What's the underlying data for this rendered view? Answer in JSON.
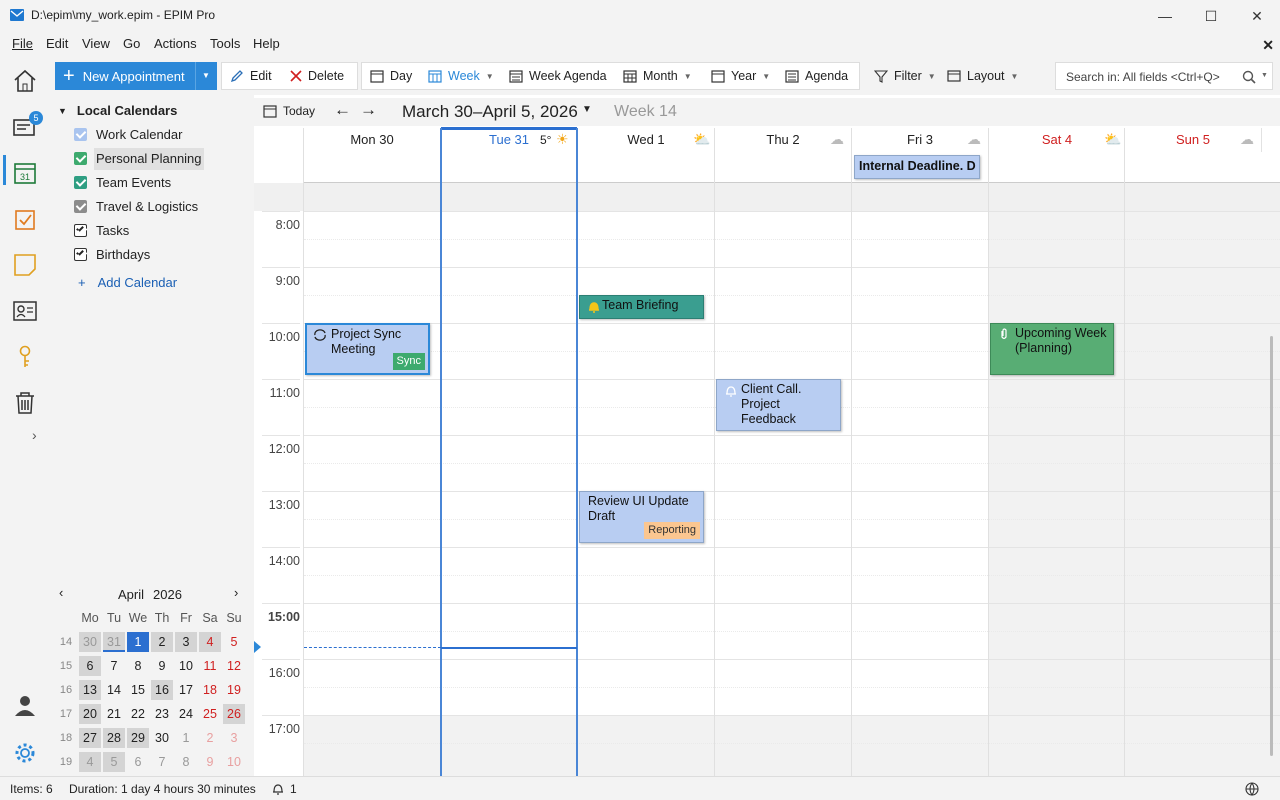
{
  "window": {
    "title": "D:\\epim\\my_work.epim - EPIM Pro",
    "minimize": "—",
    "maximize": "☐",
    "close": "✕"
  },
  "menu": {
    "file": "File",
    "edit": "Edit",
    "view": "View",
    "go": "Go",
    "actions": "Actions",
    "tools": "Tools",
    "help": "Help",
    "close": "✕"
  },
  "toolbar": {
    "new_appointment": "New Appointment",
    "edit": "Edit",
    "delete": "Delete",
    "day": "Day",
    "week": "Week",
    "week_agenda": "Week Agenda",
    "month": "Month",
    "year": "Year",
    "agenda": "Agenda",
    "filter": "Filter",
    "layout": "Layout",
    "search_placeholder": "Search in: All fields <Ctrl+Q>"
  },
  "navrail": {
    "badge": "5",
    "expand": "›"
  },
  "sidebar": {
    "header": "Local Calendars",
    "calendars": [
      {
        "label": "Work Calendar",
        "color": "#a9c4ef"
      },
      {
        "label": "Personal Planning",
        "color": "#3daa6e"
      },
      {
        "label": "Team Events",
        "color": "#2e9e82"
      },
      {
        "label": "Travel & Logistics",
        "color": "#8c8c8c"
      },
      {
        "label": "Tasks",
        "color": "#ffffff"
      },
      {
        "label": "Birthdays",
        "color": "#ffffff"
      }
    ],
    "add_calendar": "Add Calendar"
  },
  "minical": {
    "month": "April",
    "year": "2026",
    "weekdays": [
      "Mo",
      "Tu",
      "We",
      "Th",
      "Fr",
      "Sa",
      "Su"
    ],
    "weeks": [
      {
        "wk": "14",
        "days": [
          "30",
          "31",
          "1",
          "2",
          "3",
          "4",
          "5"
        ]
      },
      {
        "wk": "15",
        "days": [
          "6",
          "7",
          "8",
          "9",
          "10",
          "11",
          "12"
        ]
      },
      {
        "wk": "16",
        "days": [
          "13",
          "14",
          "15",
          "16",
          "17",
          "18",
          "19"
        ]
      },
      {
        "wk": "17",
        "days": [
          "20",
          "21",
          "22",
          "23",
          "24",
          "25",
          "26"
        ]
      },
      {
        "wk": "18",
        "days": [
          "27",
          "28",
          "29",
          "30",
          "1",
          "2",
          "3"
        ]
      },
      {
        "wk": "19",
        "days": [
          "4",
          "5",
          "6",
          "7",
          "8",
          "9",
          "10"
        ]
      }
    ]
  },
  "calnav": {
    "today": "Today",
    "range": "March 30–April 5, 2026",
    "week": "Week 14"
  },
  "days": [
    {
      "label": "Mon 30",
      "weather": ""
    },
    {
      "label": "Tue 31",
      "weather": "5°"
    },
    {
      "label": "Wed 1",
      "weather": ""
    },
    {
      "label": "Thu 2",
      "weather": ""
    },
    {
      "label": "Fri 3",
      "weather": ""
    },
    {
      "label": "Sat 4",
      "weather": ""
    },
    {
      "label": "Sun 5",
      "weather": ""
    }
  ],
  "hours": [
    "8:00",
    "9:00",
    "10:00",
    "11:00",
    "12:00",
    "13:00",
    "14:00",
    "15:00",
    "16:00",
    "17:00"
  ],
  "allday_event": "Internal Deadline. D",
  "events": {
    "project_sync": "Project Sync Meeting",
    "project_sync_tag": "Sync",
    "team_briefing": "Team Briefing",
    "upcoming_week": "Upcoming Week (Planning)",
    "client_call": "Client Call. Project Feedback",
    "review_ui": "Review UI Update Draft",
    "review_ui_tag": "Reporting"
  },
  "status": {
    "items": "Items: 6",
    "duration": "Duration: 1 day 4 hours 30 minutes",
    "reminders": "1"
  }
}
